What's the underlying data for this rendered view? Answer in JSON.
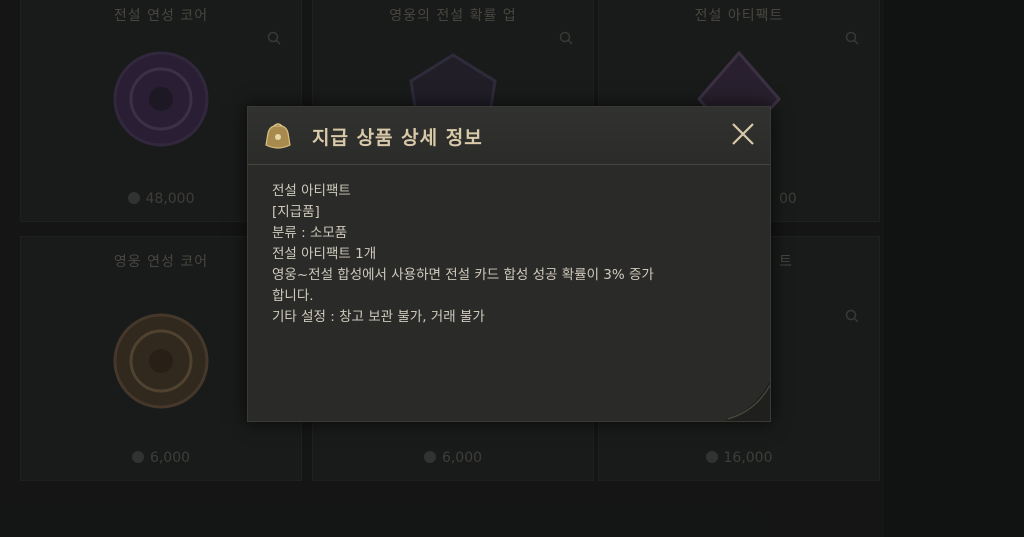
{
  "cards": [
    {
      "title": "전설 연성 코어",
      "price": "48,000",
      "gem_color": "#3c2b4d"
    },
    {
      "title": "영웅의 전설 확률 업",
      "price": "",
      "gem_color": "#2f2a3a"
    },
    {
      "title": "전설 아티팩트",
      "price": "00",
      "gem_color": "#3a2e44"
    },
    {
      "title": "영웅 연성 코어",
      "price": "6,000",
      "gem_color": "#4a3a2a"
    },
    {
      "title": "",
      "price": "6,000",
      "gem_color": "#2c2c2a"
    },
    {
      "title": "트",
      "price": "16,000",
      "gem_color": "#2c2c2a"
    }
  ],
  "dialog": {
    "title": "지급 상품 상세 정보",
    "icon": "item-bag-icon",
    "close_icon": "close-icon",
    "lines": [
      "전설 아티팩트",
      "[지급품]",
      "분류 : 소모품",
      "전설 아티팩트 1개",
      "영웅~전설 합성에서 사용하면 전설 카드 합성 성공 확률이 3% 증가",
      "합니다.",
      "기타 설정 : 창고 보관 불가, 거래 불가"
    ]
  },
  "colors": {
    "accent": "#d8c9a8",
    "text": "#cfc9bc",
    "dialog_bg": "#2a2b28"
  }
}
